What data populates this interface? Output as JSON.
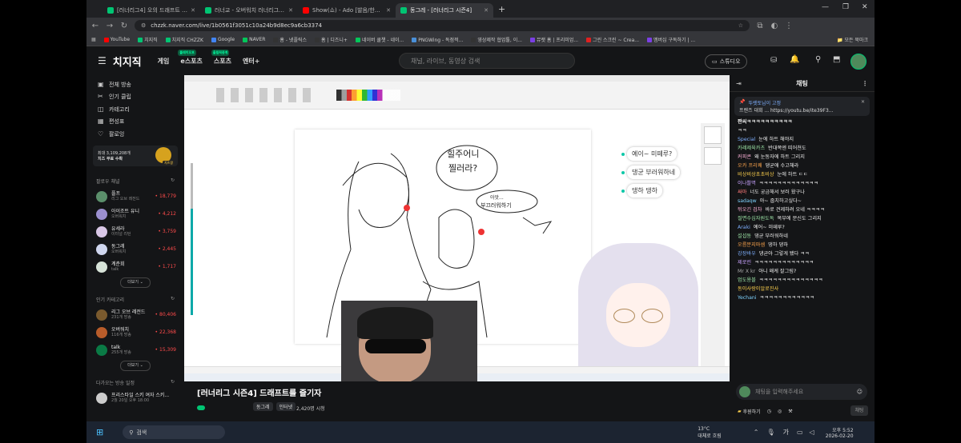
{
  "browser": {
    "tabs": [
      {
        "title": "[러너리그4] 오의 드래프트 시즌",
        "color": "#00c573",
        "active": false
      },
      {
        "title": "러너교 - 오버워치 러너리그 시즌",
        "color": "#00c573",
        "active": false
      },
      {
        "title": "Show(쇼) - Ado [발음/한국어 자막]",
        "color": "#ff0000",
        "active": false
      },
      {
        "title": "동그레 - [러너리그 시즌4]",
        "color": "#00c573",
        "active": true
      }
    ],
    "new_tab": "+",
    "url": "chzzk.naver.com/live/1b0561f3051c10a24b9d8ec9a6cb3374",
    "bookmarks": [
      {
        "label": "YouTube",
        "color": "#ff0000"
      },
      {
        "label": "치지직",
        "color": "#00c573"
      },
      {
        "label": "치지직 CHZZK",
        "color": "#00c573"
      },
      {
        "label": "Google",
        "color": "#4285f4"
      },
      {
        "label": "NAVER",
        "color": "#03c75a"
      },
      {
        "label": "홈 - 넷플릭스",
        "color": "#333333"
      },
      {
        "label": "홈 | 디즈니+",
        "color": "#333333"
      },
      {
        "label": "네이버 쿨챗 - 네이...",
        "color": "#03c75a"
      },
      {
        "label": "PNGWing - 독점적...",
        "color": "#4a90d9"
      },
      {
        "label": "영상제작 협업툴, 이...",
        "color": "#333333"
      },
      {
        "label": "뮤랫 홈 | 프리미엄...",
        "color": "#7b3fe4"
      },
      {
        "label": "그린 스크린 ~ Crea...",
        "color": "#e02020"
      },
      {
        "label": "멤버십 구독하기 | ...",
        "color": "#7b3fe4"
      }
    ],
    "all_bookmarks": "모든 북마크"
  },
  "header": {
    "logo": "치지직",
    "menu": [
      {
        "label": "게임",
        "badge": ""
      },
      {
        "label": "e스포츠",
        "badge": "플레이오프"
      },
      {
        "label": "스포츠",
        "badge": "올림픽중계"
      },
      {
        "label": "엔터+",
        "badge": ""
      }
    ],
    "search_placeholder": "채널, 라이브, 동영상 검색",
    "studio_label": "스튜디오"
  },
  "sidebar": {
    "items": [
      {
        "label": "전체 방송",
        "icon": "▣"
      },
      {
        "label": "인기 클립",
        "icon": "✂"
      },
      {
        "label": "카테고리",
        "icon": "◫"
      },
      {
        "label": "편성표",
        "icon": "▦"
      },
      {
        "label": "팔로잉",
        "icon": "♡"
      }
    ],
    "promo_text_1": "최대 3,109,208개",
    "promo_text_2": "치즈 무료 수확",
    "promo_badge": "치즈팡",
    "following_title": "팔로우 채널",
    "channels": [
      {
        "name": "플프",
        "sub": "리그 오브 레전드",
        "viewers": "18,779",
        "color": "#5b8f6b"
      },
      {
        "name": "아이조트 유니",
        "sub": "오버워치",
        "viewers": "4,212",
        "color": "#9b8fcf"
      },
      {
        "name": "유세라",
        "sub": "이터널 리턴",
        "viewers": "3,759",
        "color": "#d9c7e6"
      },
      {
        "name": "동그레",
        "sub": "오버워치",
        "viewers": "2,445",
        "color": "#cfd6ee"
      },
      {
        "name": "계춘회",
        "sub": "talk",
        "viewers": "1,717",
        "color": "#d7e3d8"
      }
    ],
    "more_label": "더보기",
    "popular_title": "인기 카테고리",
    "categories": [
      {
        "name": "리그 오브 레전드",
        "sub": "231개 방송",
        "viewers": "80,406",
        "color": "#7a5a2e"
      },
      {
        "name": "오버워치",
        "sub": "116개 방송",
        "viewers": "22,368",
        "color": "#b85c2a"
      },
      {
        "name": "talk",
        "sub": "255개 방송",
        "viewers": "15,309",
        "color": "#0a7a45"
      }
    ],
    "more_label_2": "더보기",
    "schedule_title": "다가오는 방송 일정",
    "schedule": {
      "name": "프리스타일 스키 여자 스키...",
      "time": "2월 20일 오후 18:00"
    }
  },
  "stream": {
    "overlay_chat": [
      "예이~ 미떼루?",
      "댕균 부러워하네",
      "댕하 댕하"
    ],
    "drawing_text": [
      "힐주어니",
      "찔러라?",
      "아앗...",
      "부끄러워하기"
    ],
    "title": "[러너리그 시즌4] 드래프트를 즐기자",
    "tags": [
      "동그레",
      "인터넷"
    ],
    "viewers": "2,420명 시청"
  },
  "chat": {
    "title": "채팅",
    "pinned_user": "뚜렛토님이 고정",
    "pinned_text": "프렌즈 대회 ... https://youtu.be/ite39F3...",
    "pinned_sub": "짠씨ㅋㅋㅋㅋㅋㅋㅋㅋㅋㅋ",
    "messages": [
      {
        "user": "",
        "text": "ㅋㅋ",
        "color": "#aaaaaa"
      },
      {
        "user": "Special",
        "text": "눈에 하트 해야지",
        "color": "#7fb0ff"
      },
      {
        "user": "카레제육카츠",
        "text": "반대쪽엔 띠어쳔도",
        "color": "#9ee6a8"
      },
      {
        "user": "커피콘",
        "text": "왜 눈동자에 하트 그리지",
        "color": "#ffb3d9"
      },
      {
        "user": "오카 프리쾌",
        "text": "댕균애 수고해라",
        "color": "#ffa64d"
      },
      {
        "user": "비상비상초초비상",
        "text": "눈에 하트 ㄷㄷ",
        "color": "#ffd24d"
      },
      {
        "user": "이나쁠멱",
        "text": "ㅋㅋㅋㅋㅋㅋㅋㅋㅋㅋㅋㅋㅋ",
        "color": "#c9a3ff"
      },
      {
        "user": "싸마",
        "text": "너도 궁금해서 보러 왔구나",
        "color": "#ff7a7a"
      },
      {
        "user": "sadaqw",
        "text": "아~ 줍치하고싶다~",
        "color": "#7fd4ff"
      },
      {
        "user": "뒤오긴 검차",
        "text": "바로 견제하려 오네 ㅋㅋㅋㅋ",
        "color": "#ffb3d9"
      },
      {
        "user": "절면수심자원도독",
        "text": "복부에 문신도 그리지",
        "color": "#9ee6a8"
      },
      {
        "user": "Araki",
        "text": "예어~ 미떼루?",
        "color": "#7fb0ff"
      },
      {
        "user": "설섭동",
        "text": "댕균 부러워하네",
        "color": "#9ee6a8"
      },
      {
        "user": "오름분지마셈",
        "text": "댕하 댕하",
        "color": "#ffa64d"
      },
      {
        "user": "강장바우",
        "text": "댕균아 그렇게 됐다 ㅋㅋ",
        "color": "#7fb0ff"
      },
      {
        "user": "제로린",
        "text": "ㅋㅋㅋㅋㅋㅋㅋㅋㅋㅋㅋㅋㅋ",
        "color": "#c9a3ff"
      },
      {
        "user": "Mr X kr",
        "text": "아니 왜케 잘그림?",
        "color": "#aaaaaa"
      },
      {
        "user": "엄도용블",
        "text": "ㅋㅋㅋㅋㅋㅋㅋㅋㅋㅋㅋㅋㅋㅋ",
        "color": "#9ee6a8"
      },
      {
        "user": "동이사랑이알로진사",
        "text": "",
        "color": "#ffd24d"
      },
      {
        "user": "Yechani",
        "text": "ㅋㅋㅋㅋㅋㅋㅋㅋㅋㅋㅋㅋ",
        "color": "#7fd4ff"
      }
    ],
    "input_placeholder": "채팅을 입력해주세요",
    "donate_label": "후원하기",
    "send_label": "채팅"
  },
  "taskbar": {
    "search_placeholder": "검색",
    "weather": "13°C",
    "weather_sub": "대체로 흐림",
    "ime": "가",
    "time": "오후 5:52",
    "date": "2026-02-20"
  }
}
